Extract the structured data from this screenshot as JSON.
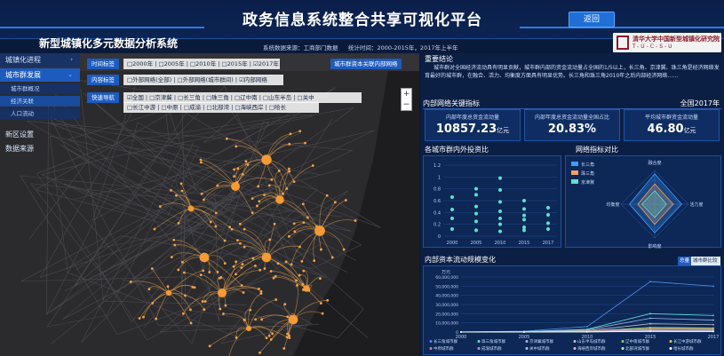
{
  "header": {
    "title": "政务信息系统整合共享可视化平台",
    "back_button": "返回"
  },
  "subheader": {
    "system_title": "新型城镇化多元数据分析系统",
    "data_source": "系统数据来源：工商部门数据",
    "time_span": "统计时间：2000-2015年，2017年上半年",
    "logo_text": "清华大学中国新型城镇化研究院",
    "logo_sub": "T-U-C-S-U"
  },
  "nav": {
    "items": [
      {
        "label": "城镇化进程"
      },
      {
        "label": "城市群发展"
      },
      {
        "label": "城市群概况"
      },
      {
        "label": "经济关联"
      },
      {
        "label": "人口流动"
      },
      {
        "label": "新区设置"
      },
      {
        "label": "数据来源"
      }
    ]
  },
  "filters": {
    "time_label": "时间标签",
    "time_options": "□2000年 | □2005年 | □2010年 | □2015年 | ☑2017年",
    "content_label": "内容标签",
    "content_options": "□外部网络(全部) | □外部网络(城市群间) | ☑内部网络",
    "quick_label": "快速导航",
    "quick_row1": "☑全国 | □京津冀 | □长三角 | □珠三角 | □辽中南 | □山东半岛 | □关中",
    "quick_row2": "□长江中游 | □中原 | □成渝 | □北部湾 | □海峡西岸 | □哈长",
    "map_caption": "城市群资本关联内部网络"
  },
  "conclusion": {
    "title": "重要结论",
    "text": "城市群对全国经济流动具有明显贡献，城市群内部的资金流动量占全国的1/5以上，长三角、京津冀、珠三角是经济网络发育最好的城市群，在融合、活力、均衡度方面具有明显优势。长三角和珠三角2010年之后内部经济网络……"
  },
  "kpis": {
    "title": "内部网络关键指标",
    "scope": "全国2017年",
    "items": [
      {
        "label": "内部年度总资金流动量",
        "value": "10857.23",
        "unit": "亿元"
      },
      {
        "label": "内部年度总资金流动量全国占比",
        "value": "20.83%",
        "unit": ""
      },
      {
        "label": "平均城市群资金流动量",
        "value": "46.80",
        "unit": "亿元"
      }
    ]
  },
  "scatter_title": "各城市群内外投资比",
  "radar_title": "网络指标对比",
  "flow_title": "内部资本流动规模变化",
  "flow_toggle": {
    "a": "总量",
    "b": "城市群比较"
  },
  "chart_data": [
    {
      "type": "scatter",
      "title": "各城市群内外投资比",
      "x": [
        "2000",
        "2005",
        "2010",
        "2015",
        "2017"
      ],
      "ylim": [
        0,
        1.2
      ],
      "yticks": [
        "0",
        "0.2",
        "0.4",
        "0.6",
        "0.8",
        "1",
        "1.2"
      ],
      "points": [
        {
          "x": "2000",
          "y": [
            0.12,
            0.3,
            0.45,
            0.66
          ]
        },
        {
          "x": "2005",
          "y": [
            0.1,
            0.25,
            0.38,
            0.5,
            0.7,
            0.8
          ]
        },
        {
          "x": "2010",
          "y": [
            0.08,
            0.2,
            0.3,
            0.42,
            0.58,
            0.78,
            0.98
          ]
        },
        {
          "x": "2015",
          "y": [
            0.1,
            0.15,
            0.28,
            0.35,
            0.46,
            0.6
          ]
        },
        {
          "x": "2017",
          "y": [
            0.12,
            0.22,
            0.36,
            0.48
          ]
        }
      ]
    },
    {
      "type": "radar",
      "title": "网络指标对比",
      "axes": [
        "融合度",
        "活力度",
        "影响度",
        "均衡度"
      ],
      "series": [
        {
          "name": "长三角",
          "values": [
            0.9,
            0.8,
            0.85,
            0.75
          ],
          "color": "#3aa0ff"
        },
        {
          "name": "珠三角",
          "values": [
            0.6,
            0.55,
            0.6,
            0.5
          ],
          "color": "#f0a060"
        },
        {
          "name": "京津冀",
          "values": [
            0.4,
            0.35,
            0.4,
            0.38
          ],
          "color": "#5fe0d0"
        }
      ]
    },
    {
      "type": "line",
      "title": "内部资本流动规模变化",
      "ylabel": "万元",
      "x": [
        "2000",
        "2005",
        "2010",
        "2015",
        "2017"
      ],
      "ylim": [
        0,
        60000000
      ],
      "yticks": [
        "0",
        "10,000,000",
        "20,000,000",
        "30,000,000",
        "40,000,000",
        "50,000,000",
        "60,000,000"
      ],
      "series": [
        {
          "name": "长三角城市群",
          "values": [
            200000,
            900000,
            6000000,
            55000000,
            50000000
          ],
          "color": "#4f8fe8"
        },
        {
          "name": "珠三角城市群",
          "values": [
            100000,
            500000,
            3000000,
            20000000,
            18000000
          ],
          "color": "#5fe0d0"
        },
        {
          "name": "京津冀城市群",
          "values": [
            80000,
            400000,
            2500000,
            15000000,
            13000000
          ],
          "color": "#9fb9e8"
        },
        {
          "name": "山东半岛城市群",
          "values": [
            50000,
            200000,
            1500000,
            9000000,
            8000000
          ],
          "color": "#c0c0c0"
        },
        {
          "name": "辽中南城市群",
          "values": [
            40000,
            150000,
            1000000,
            5000000,
            4500000
          ],
          "color": "#7fd38a"
        },
        {
          "name": "长江中游城市群",
          "values": [
            30000,
            120000,
            900000,
            4000000,
            3800000
          ],
          "color": "#e0c070"
        },
        {
          "name": "中原城市群",
          "values": [
            20000,
            100000,
            700000,
            3000000,
            2800000
          ],
          "color": "#e08080"
        },
        {
          "name": "成渝城市群",
          "values": [
            20000,
            90000,
            600000,
            2500000,
            2300000
          ],
          "color": "#c08fe0"
        },
        {
          "name": "关中城市群",
          "values": [
            15000,
            60000,
            400000,
            1500000,
            1400000
          ],
          "color": "#8fd0ff"
        },
        {
          "name": "海峡西岸城市群",
          "values": [
            10000,
            50000,
            300000,
            1200000,
            1100000
          ],
          "color": "#ffb0d0"
        },
        {
          "name": "北部湾城市群",
          "values": [
            8000,
            30000,
            200000,
            800000,
            700000
          ],
          "color": "#b0ffb0"
        },
        {
          "name": "哈长城市群",
          "values": [
            6000,
            25000,
            150000,
            600000,
            500000
          ],
          "color": "#ffffff"
        }
      ]
    }
  ]
}
